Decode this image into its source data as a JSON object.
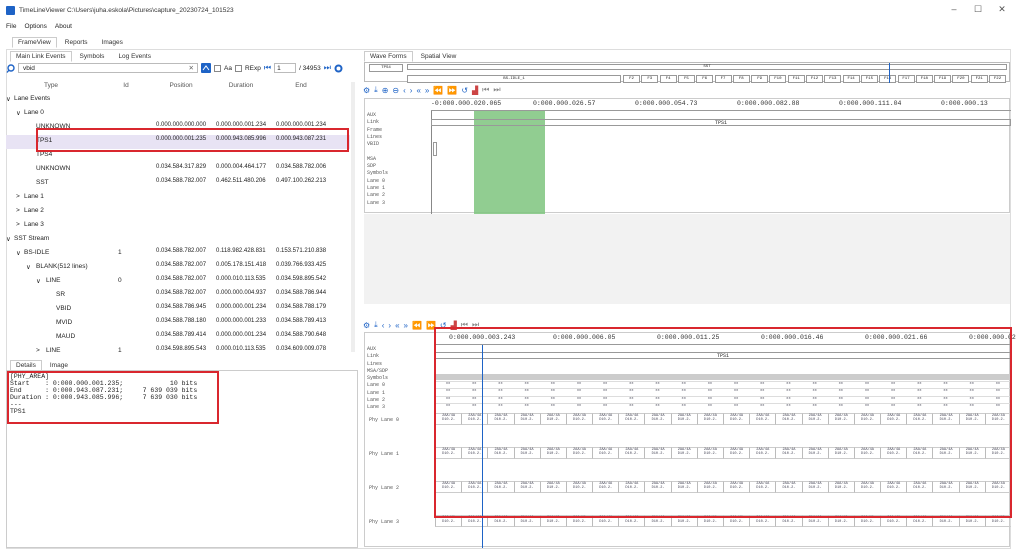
{
  "window": {
    "title": "TimeLineViewer C:\\Users\\juha.eskola\\Pictures\\capture_20230724_101523",
    "min": "–",
    "max": "☐",
    "close": "✕"
  },
  "menu": [
    "File",
    "Options",
    "About"
  ],
  "main_tabs": [
    "FrameView",
    "Reports",
    "Images"
  ],
  "left_tabs": [
    "Main Link Events",
    "Symbols",
    "Log Events"
  ],
  "search": {
    "value": "vbid",
    "clear": "✕",
    "aa": "Aa",
    "regexp": "RExp",
    "current": "1",
    "total": "/ 34953"
  },
  "columns": {
    "type": "Type",
    "id": "Id",
    "position": "Position",
    "duration": "Duration",
    "end": "End"
  },
  "tree": [
    {
      "label": "Lane Events",
      "indent": 0,
      "arrow": "∨",
      "id": "",
      "pos": "",
      "dur": "",
      "end": ""
    },
    {
      "label": "Lane 0",
      "indent": 1,
      "arrow": "∨",
      "id": "",
      "pos": "",
      "dur": "",
      "end": ""
    },
    {
      "label": "UNKNOWN",
      "indent": 2,
      "arrow": "",
      "id": "",
      "pos": "0.000.000.000.000",
      "dur": "0.000.000.001.234",
      "end": "0.000.000.001.234"
    },
    {
      "label": "TPS1",
      "indent": 2,
      "arrow": "",
      "id": "",
      "pos": "0.000.000.001.235",
      "dur": "0.000.943.085.996",
      "end": "0.000.943.087.231"
    },
    {
      "label": "TPS4",
      "indent": 2,
      "arrow": "",
      "id": "",
      "pos": "",
      "dur": "",
      "end": ""
    },
    {
      "label": "UNKNOWN",
      "indent": 2,
      "arrow": "",
      "id": "",
      "pos": "0.034.584.317.829",
      "dur": "0.000.004.464.177",
      "end": "0.034.588.782.006"
    },
    {
      "label": "SST",
      "indent": 2,
      "arrow": "",
      "id": "",
      "pos": "0.034.588.782.007",
      "dur": "0.462.511.480.206",
      "end": "0.497.100.262.213"
    },
    {
      "label": "Lane 1",
      "indent": 1,
      "arrow": ">",
      "id": "",
      "pos": "",
      "dur": "",
      "end": ""
    },
    {
      "label": "Lane 2",
      "indent": 1,
      "arrow": ">",
      "id": "",
      "pos": "",
      "dur": "",
      "end": ""
    },
    {
      "label": "Lane 3",
      "indent": 1,
      "arrow": ">",
      "id": "",
      "pos": "",
      "dur": "",
      "end": ""
    },
    {
      "label": "SST Stream",
      "indent": 0,
      "arrow": "∨",
      "id": "",
      "pos": "",
      "dur": "",
      "end": ""
    },
    {
      "label": "BS-IDLE",
      "indent": 1,
      "arrow": "∨",
      "id": "1",
      "pos": "0.034.588.782.007",
      "dur": "0.118.982.428.831",
      "end": "0.153.571.210.838"
    },
    {
      "label": "BLANK(512 lines)",
      "indent": 2,
      "arrow": "∨",
      "id": "",
      "pos": "0.034.588.782.007",
      "dur": "0.005.178.151.418",
      "end": "0.039.766.933.425"
    },
    {
      "label": "LINE",
      "indent": 3,
      "arrow": "∨",
      "id": "0",
      "pos": "0.034.588.782.007",
      "dur": "0.000.010.113.535",
      "end": "0.034.598.895.542"
    },
    {
      "label": "SR",
      "indent": 4,
      "arrow": "",
      "id": "",
      "pos": "0.034.588.782.007",
      "dur": "0.000.000.004.937",
      "end": "0.034.588.786.944"
    },
    {
      "label": "VBID",
      "indent": 4,
      "arrow": "",
      "id": "",
      "pos": "0.034.588.786.945",
      "dur": "0.000.000.001.234",
      "end": "0.034.588.788.179"
    },
    {
      "label": "MVID",
      "indent": 4,
      "arrow": "",
      "id": "",
      "pos": "0.034.588.788.180",
      "dur": "0.000.000.001.233",
      "end": "0.034.588.789.413"
    },
    {
      "label": "MAUD",
      "indent": 4,
      "arrow": "",
      "id": "",
      "pos": "0.034.588.789.414",
      "dur": "0.000.000.001.234",
      "end": "0.034.588.790.648"
    },
    {
      "label": "LINE",
      "indent": 3,
      "arrow": ">",
      "id": "1",
      "pos": "0.034.598.895.543",
      "dur": "0.000.010.113.535",
      "end": "0.034.609.009.078"
    }
  ],
  "detail_tabs": [
    "Details",
    "Image"
  ],
  "details": {
    "l1": "[PHY_AREA]",
    "l2": "Start    : 0:000.000.001.235;            10 bits",
    "l3": "End      : 0:000.943.087.231;     7 639 039 bits",
    "l4": "Duration : 0:000.943.085.996;     7 639 030 bits",
    "l5": "---",
    "l6": "TPS1"
  },
  "wave_tabs": [
    "Wave Forms",
    "Spatial View"
  ],
  "overview": {
    "tps4": "TPS4",
    "sst": "SST",
    "bsidle": "BS-IDLE_1",
    "frames": [
      "F2",
      "F3",
      "F4",
      "F5",
      "F6",
      "F7",
      "F8",
      "F9",
      "F10",
      "F11",
      "F12",
      "F13",
      "F14",
      "F15",
      "F16",
      "F17",
      "F18",
      "F19",
      "F20",
      "F21",
      "F22"
    ]
  },
  "upper_ruler": [
    "-0:000.000.020.065",
    "0:000.000.026.57",
    "0:000.000.054.73",
    "0:000.000.082.88",
    "0:000.000.111.04",
    "0:000.000.13"
  ],
  "upper_labels": [
    "AUX",
    "Link",
    "Frame",
    "Lines",
    "VBID",
    "",
    "MSA",
    "SDP",
    "Symbols",
    "Lane 0",
    "Lane 1",
    "Lane 2",
    "Lane 3"
  ],
  "upper_tps1": "TPS1",
  "lower_ruler": [
    "0:000.000.003.243",
    "0:000.000.006.05",
    "0:000.000.011.25",
    "0:000.000.016.46",
    "0:000.000.021.66",
    "0:000.000.02"
  ],
  "lower_labels": [
    "AUX",
    "Link",
    "Lines",
    "MSA/SDP",
    "Symbols",
    "Lane 0",
    "Lane 1",
    "Lane 2",
    "Lane 3"
  ],
  "lower_tps1": "TPS1",
  "phy_lanes": [
    "Phy Lane 0",
    "Phy Lane 1",
    "Phy Lane 2",
    "Phy Lane 3"
  ],
  "cell_top": "2AA/4A",
  "cell_bot": "D10.2-",
  "sym_cell": "xx"
}
